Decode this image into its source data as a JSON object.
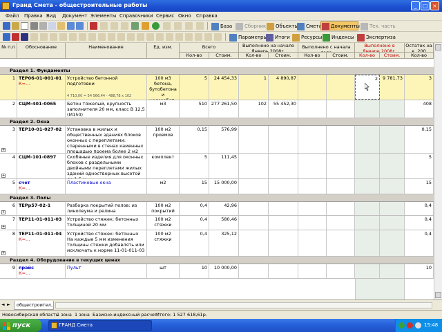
{
  "window": {
    "title": "Гранд Смета - общестроительные работы"
  },
  "menu": [
    "Файл",
    "Правка",
    "Вид",
    "Документ",
    "Элементы",
    "Справочники",
    "Сервис",
    "Окно",
    "Справка"
  ],
  "toolbar1": {
    "base": "База",
    "collections": "Сборник",
    "objects": "Объекты",
    "estimate": "Смета",
    "documents": "Документы",
    "tech": "Тех. часть"
  },
  "toolbar2": {
    "params": "Параметры",
    "totals": "Итоги",
    "resources": "Ресурсы",
    "indexes": "Индексы",
    "expertise": "Экспертиза"
  },
  "header": {
    "col_no": "№ п.п",
    "col_basis": "Обоснование",
    "col_name": "Наименование",
    "col_unit": "Ед. изм.",
    "col_total": "Всего",
    "col_done_start": "Выполнено на начало Январь 2008г.",
    "col_done_since": "Выполнено с начала года",
    "col_done_in": "Выполнено в Январе 2008г.",
    "col_rest": "Остаток на к. 200",
    "qty": "Кол-во",
    "cost": "Стоим."
  },
  "sections": [
    {
      "label": "Раздел 1. Фундаменты"
    },
    {
      "label": "Раздел 2. Окна"
    },
    {
      "label": "Раздел 3. Полы"
    },
    {
      "label": "Раздел 4. Оборудование в текущих ценах"
    }
  ],
  "rows": [
    {
      "no": "1",
      "basis": "ТЕР06-01-001-01",
      "k": "К=...",
      "name": "Устройство бетонной подготовки",
      "sub": "4 710,00 = 54 566,44 - 488,78 x 102",
      "unit": "100 м3 бетона, бутобетона и железобет...",
      "qty": "5",
      "cost": "24 454,33",
      "ds_qty": "1",
      "ds_cost": "4 890,87",
      "dy_qty": "",
      "dy_cost": "",
      "dm_qty": "2",
      "dm_cost": "9 781,73",
      "rest": "3"
    },
    {
      "no": "2",
      "basis": "СЦМ-401-0065",
      "k": "",
      "name": "Бетон тяжелый, крупность заполнителя 20 мм, класс В 12,5 (М150)",
      "sub": "",
      "unit": "м3",
      "qty": "510",
      "cost": "277 261,50",
      "ds_qty": "102",
      "ds_cost": "55 452,30",
      "dy_qty": "",
      "dy_cost": "",
      "dm_qty": "",
      "dm_cost": "",
      "rest": "408"
    },
    {
      "no": "3",
      "basis": "ТЕР10-01-027-02",
      "k": "",
      "name": "Установка в жилых и общественных зданиях блоков оконных с переплетами: спаренными в стенах каменных площадью проема более 2 м2",
      "sub": "",
      "unit": "100 м2 проемов",
      "qty": "0,15",
      "cost": "576,99",
      "ds_qty": "",
      "ds_cost": "",
      "dy_qty": "",
      "dy_cost": "",
      "dm_qty": "",
      "dm_cost": "",
      "rest": "0,15"
    },
    {
      "no": "4",
      "basis": "СЦМ-101-0897",
      "k": "",
      "name": "Скобяные изделия для оконных блоков с раздельными двойными переплетами жилых зданий одностворных высотой до 1,5 м",
      "sub": "",
      "unit": "комплект",
      "qty": "5",
      "cost": "111,45",
      "ds_qty": "",
      "ds_cost": "",
      "dy_qty": "",
      "dy_cost": "",
      "dm_qty": "",
      "dm_cost": "",
      "rest": "5"
    },
    {
      "no": "5",
      "basis": "счет",
      "k": "К=...",
      "name": "Пластиковые окна",
      "sub": "",
      "unit": "м2",
      "qty": "15",
      "cost": "15 000,00",
      "ds_qty": "",
      "ds_cost": "",
      "dy_qty": "",
      "dy_cost": "",
      "dm_qty": "",
      "dm_cost": "",
      "rest": "15"
    },
    {
      "no": "6",
      "basis": "ТЕРр57-02-1",
      "k": "",
      "name": "Разборка покрытий полов: из линолеума и релина",
      "sub": "",
      "unit": "100 м2 покрытий",
      "qty": "0,4",
      "cost": "42,96",
      "ds_qty": "",
      "ds_cost": "",
      "dy_qty": "",
      "dy_cost": "",
      "dm_qty": "",
      "dm_cost": "",
      "rest": "0,4"
    },
    {
      "no": "7",
      "basis": "ТЕР11-01-011-03",
      "k": "",
      "name": "Устройство стяжек: бетонных толщиной 20 мм",
      "sub": "",
      "unit": "100 м2 стяжки",
      "qty": "0,4",
      "cost": "580,46",
      "ds_qty": "",
      "ds_cost": "",
      "dy_qty": "",
      "dy_cost": "",
      "dm_qty": "",
      "dm_cost": "",
      "rest": "0,4"
    },
    {
      "no": "8",
      "basis": "ТЕР11-01-011-04",
      "k": "К=...",
      "name": "Устройство стяжек: бетонных На каждые 5 мм изменения толщины стяжки добавлять или исключать к норме 11-01-011-03",
      "sub": "",
      "unit": "100 м2 стяжки",
      "qty": "0,4",
      "cost": "325,12",
      "ds_qty": "",
      "ds_cost": "",
      "dy_qty": "",
      "dy_cost": "",
      "dm_qty": "",
      "dm_cost": "",
      "rest": "0,4"
    },
    {
      "no": "9",
      "basis": "прайс",
      "k": "К=...",
      "name": "Пульт",
      "sub": "",
      "unit": "шт",
      "qty": "10",
      "cost": "10 000,00",
      "ds_qty": "",
      "ds_cost": "",
      "dy_qty": "",
      "dy_cost": "",
      "dm_qty": "",
      "dm_cost": "",
      "rest": "10"
    }
  ],
  "sheet_tab": "общестроител...",
  "status": {
    "region": "Новосибирская область",
    "zone1": "1 зона",
    "zone2": "1 зона",
    "method": "Базисно-индексный расчет",
    "total": "Итого: 1 527 618,61р."
  },
  "taskbar": {
    "start": "пуск",
    "task": "ГРАНД Смета",
    "clock": "15:48"
  }
}
